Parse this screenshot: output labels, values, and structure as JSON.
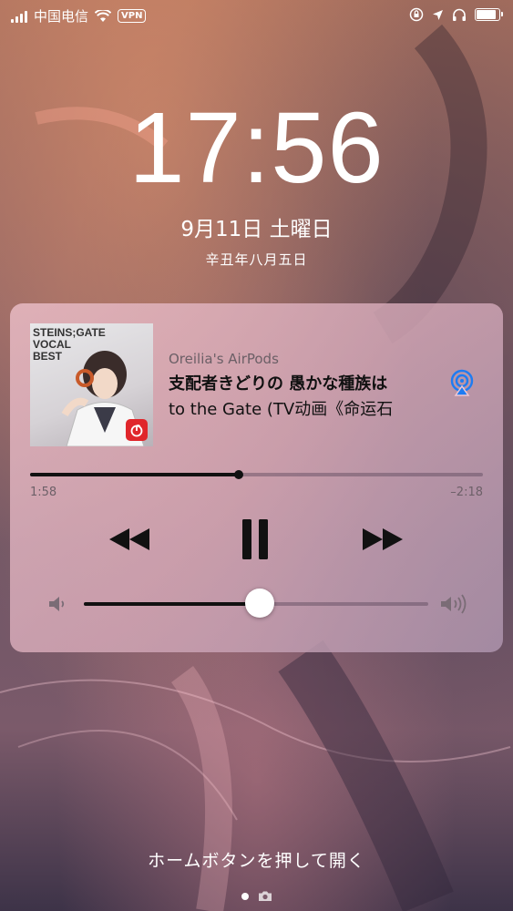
{
  "status_bar": {
    "carrier": "中国电信",
    "vpn": "VPN",
    "battery_level": 0.9
  },
  "lock_screen": {
    "time": "17:56",
    "date": "9月11日 土曜日",
    "lunar_date": "辛丑年八月五日"
  },
  "now_playing": {
    "album_art_text": "STEINS;GATE\nVOCAL\nBEST",
    "source": "Oreilia's AirPods",
    "title": "支配者きどりの 愚かな種族は",
    "subtitle": "to the Gate (TV动画《命运石",
    "elapsed": "1:58",
    "remaining": "–2:18",
    "progress": 0.46,
    "volume": 0.51
  },
  "footer": {
    "unlock_hint": "ホームボタンを押して開く",
    "page_count": 2,
    "current_page": 0
  },
  "icons": [
    "signal-icon",
    "wifi-icon",
    "orientation-lock-icon",
    "location-icon",
    "headphones-icon",
    "battery-icon",
    "airplay-icon",
    "rewind-icon",
    "pause-icon",
    "fast-forward-icon",
    "volume-low-icon",
    "volume-high-icon",
    "camera-icon"
  ],
  "colors": {
    "accent_airplay": "#1e7cf2",
    "badge_red": "#e0262b"
  }
}
